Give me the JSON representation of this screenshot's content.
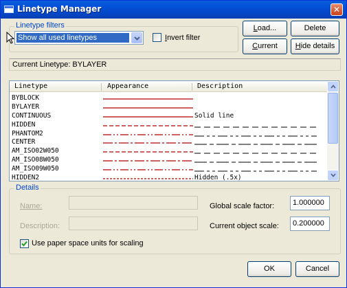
{
  "window": {
    "title": "Linetype Manager",
    "close_glyph": "✕"
  },
  "filters": {
    "group_label": "Linetype filters",
    "selected_filter": "Show all used linetypes",
    "invert_filter_label": "Invert filter",
    "invert_filter_checked": false
  },
  "toolbar": {
    "load_label": "Load...",
    "delete_label": "Delete",
    "current_label": "Current",
    "hide_details_label": "Hide details"
  },
  "current_linetype": {
    "text": "Current Linetype: BYLAYER"
  },
  "list": {
    "columns": [
      "Linetype",
      "Appearance",
      "Description"
    ],
    "rows": [
      {
        "name": "BYBLOCK",
        "pattern": "solid",
        "description": ""
      },
      {
        "name": "BYLAYER",
        "pattern": "solid",
        "description": ""
      },
      {
        "name": "CONTINUOUS",
        "pattern": "solid",
        "description": "Solid line"
      },
      {
        "name": "HIDDEN",
        "pattern": "hidden",
        "description": "__ __ __ __ __ __ __ __"
      },
      {
        "name": "PHANTOM2",
        "pattern": "phantom",
        "description": "___ _ _ ___ _ _ ___ _ _"
      },
      {
        "name": "CENTER",
        "pattern": "center",
        "description": "____ _ ____ _ ____ _ __"
      },
      {
        "name": "AM_ISO02W050",
        "pattern": "hidden",
        "description": "__ __ __ __ __ __ __ __"
      },
      {
        "name": "AM_ISO08W050",
        "pattern": "center",
        "description": "____ __ ____ __ ____ _"
      },
      {
        "name": "AM_ISO09W050",
        "pattern": "phantom",
        "description": "____ __ __ ____ __ __"
      },
      {
        "name": "HIDDEN2",
        "pattern": "fine",
        "description": "Hidden (.5x)"
      }
    ]
  },
  "details": {
    "group_label": "Details",
    "name_label": "Name:",
    "description_label": "Description:",
    "name_value": "",
    "description_value": "",
    "global_scale_label": "Global scale factor:",
    "global_scale_value": "1.000000",
    "current_scale_label": "Current object scale:",
    "current_scale_value": "0.200000",
    "paper_space_label": "Use paper space units for scaling",
    "paper_space_checked": true
  },
  "footer": {
    "ok_label": "OK",
    "cancel_label": "Cancel"
  },
  "colors": {
    "accent": "#0046d5",
    "linetype_red": "#b00000",
    "title_blue": "#0350d6"
  }
}
